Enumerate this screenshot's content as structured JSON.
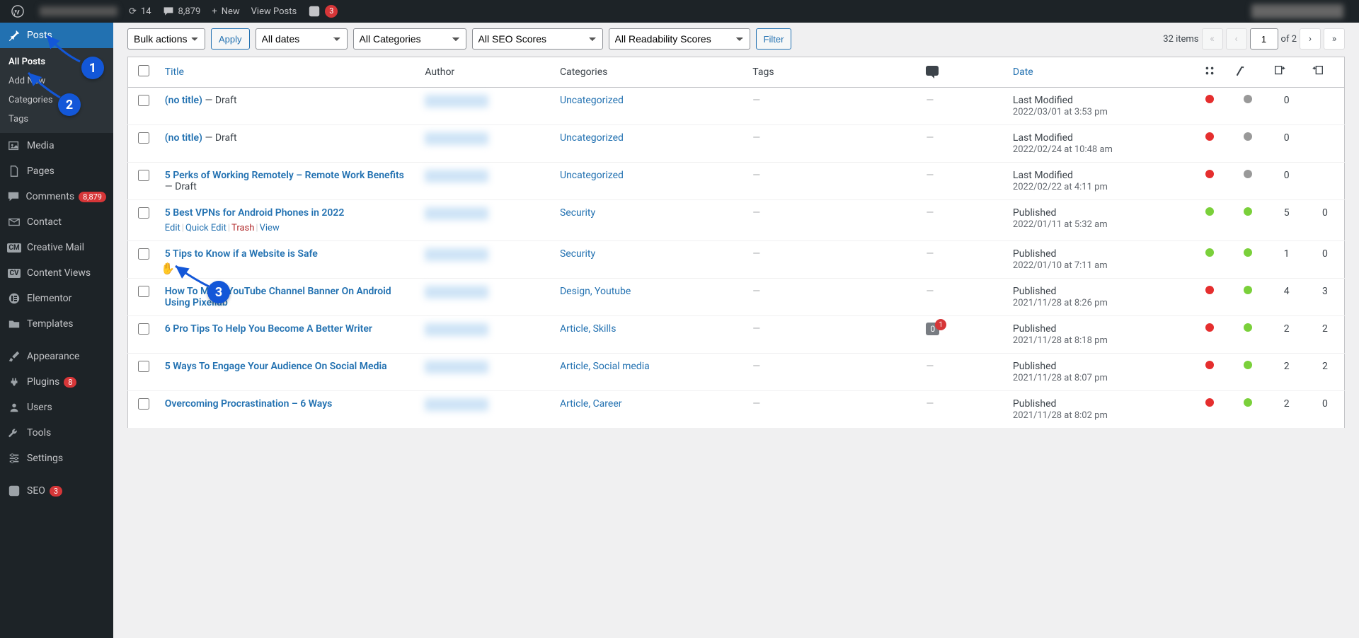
{
  "adminbar": {
    "updates": "14",
    "comments": "8,879",
    "new": "New",
    "view_posts": "View Posts",
    "yoast_notif": "3"
  },
  "sidebar": {
    "posts": "Posts",
    "submenu": {
      "all_posts": "All Posts",
      "add_new": "Add New",
      "categories": "Categories",
      "tags": "Tags"
    },
    "media": "Media",
    "pages": "Pages",
    "comments": "Comments",
    "comments_count": "8,879",
    "contact": "Contact",
    "creative_mail": "Creative Mail",
    "content_views": "Content Views",
    "elementor": "Elementor",
    "templates": "Templates",
    "appearance": "Appearance",
    "plugins": "Plugins",
    "plugins_count": "8",
    "users": "Users",
    "tools": "Tools",
    "settings": "Settings",
    "seo": "SEO",
    "seo_count": "3"
  },
  "filters": {
    "bulk_actions": "Bulk actions",
    "apply": "Apply",
    "all_dates": "All dates",
    "all_categories": "All Categories",
    "all_seo": "All SEO Scores",
    "all_readability": "All Readability Scores",
    "filter": "Filter"
  },
  "paging": {
    "items": "32 items",
    "current": "1",
    "of": "of 2"
  },
  "columns": {
    "title": "Title",
    "author": "Author",
    "categories": "Categories",
    "tags": "Tags",
    "date": "Date"
  },
  "row_actions": {
    "edit": "Edit",
    "quick_edit": "Quick Edit",
    "trash": "Trash",
    "view": "View"
  },
  "annotations": {
    "one": "1",
    "two": "2",
    "three": "3"
  },
  "rows": [
    {
      "title": "(no title)",
      "state": " — Draft",
      "categories": "Uncategorized",
      "tags": "—",
      "comments": "—",
      "date_label": "Last Modified",
      "date": "2022/03/01 at 3:53 pm",
      "seo": "red",
      "read": "grey",
      "links": "0",
      "intlinks": "",
      "show_actions": false
    },
    {
      "title": "(no title)",
      "state": " — Draft",
      "categories": "Uncategorized",
      "tags": "—",
      "comments": "—",
      "date_label": "Last Modified",
      "date": "2022/02/24 at 10:48 am",
      "seo": "red",
      "read": "grey",
      "links": "0",
      "intlinks": "",
      "show_actions": false
    },
    {
      "title": "5 Perks of Working Remotely – Remote Work Benefits",
      "state": " — Draft",
      "categories": "Uncategorized",
      "tags": "—",
      "comments": "—",
      "date_label": "Last Modified",
      "date": "2022/02/22 at 4:11 pm",
      "seo": "red",
      "read": "grey",
      "links": "0",
      "intlinks": "",
      "show_actions": false
    },
    {
      "title": "5 Best VPNs for Android Phones in 2022",
      "state": "",
      "categories": "Security",
      "tags": "—",
      "comments": "—",
      "date_label": "Published",
      "date": "2022/01/11 at 5:32 am",
      "seo": "green",
      "read": "green",
      "links": "5",
      "intlinks": "0",
      "show_actions": true
    },
    {
      "title": "5 Tips to Know if a Website is Safe",
      "state": "",
      "categories": "Security",
      "tags": "—",
      "comments": "—",
      "date_label": "Published",
      "date": "2022/01/10 at 7:11 am",
      "seo": "green",
      "read": "green",
      "links": "1",
      "intlinks": "0",
      "show_actions": false
    },
    {
      "title": "How To Make YouTube Channel Banner On Android Using Pixellab",
      "state": "",
      "categories": "Design, Youtube",
      "tags": "—",
      "comments": "—",
      "date_label": "Published",
      "date": "2021/11/28 at 8:26 pm",
      "seo": "red",
      "read": "green",
      "links": "4",
      "intlinks": "3",
      "show_actions": false
    },
    {
      "title": "6 Pro Tips To Help You Become A Better Writer",
      "state": "",
      "categories": "Article, Skills",
      "tags": "—",
      "comments": "bubble",
      "comment_approved": "0",
      "comment_pending": "1",
      "date_label": "Published",
      "date": "2021/11/28 at 8:18 pm",
      "seo": "red",
      "read": "green",
      "links": "2",
      "intlinks": "2",
      "show_actions": false
    },
    {
      "title": "5 Ways To Engage Your Audience On Social Media",
      "state": "",
      "categories": "Article, Social media",
      "tags": "—",
      "comments": "—",
      "date_label": "Published",
      "date": "2021/11/28 at 8:07 pm",
      "seo": "red",
      "read": "green",
      "links": "2",
      "intlinks": "2",
      "show_actions": false
    },
    {
      "title": "Overcoming Procrastination – 6 Ways",
      "state": "",
      "categories": "Article, Career",
      "tags": "—",
      "comments": "—",
      "date_label": "Published",
      "date": "2021/11/28 at 8:02 pm",
      "seo": "red",
      "read": "green",
      "links": "2",
      "intlinks": "0",
      "show_actions": false
    }
  ]
}
